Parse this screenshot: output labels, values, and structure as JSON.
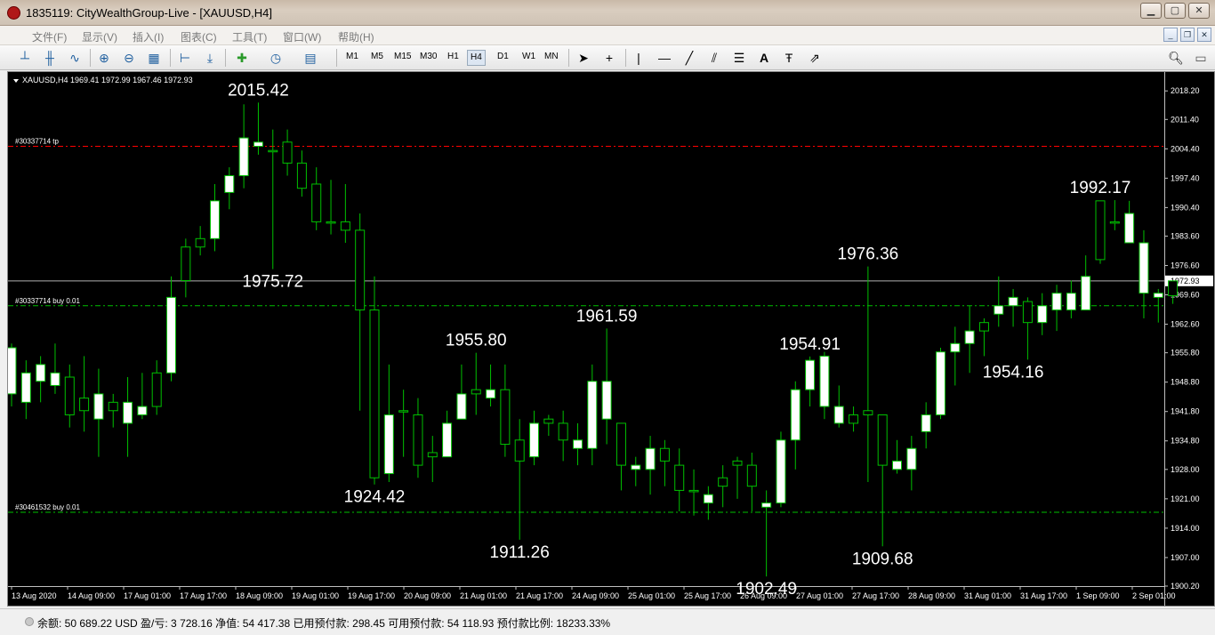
{
  "window": {
    "title": "1835119: CityWealthGroup-Live - [XAUUSD,H4]"
  },
  "menu": [
    "文件(F)",
    "显示(V)",
    "插入(I)",
    "图表(C)",
    "工具(T)",
    "窗口(W)",
    "帮助(H)"
  ],
  "timeframes": [
    "M1",
    "M5",
    "M15",
    "M30",
    "H1",
    "H4",
    "D1",
    "W1",
    "MN"
  ],
  "active_timeframe": "H4",
  "toolbar_icons": [
    "bar-chart-icon",
    "candlestick-icon",
    "line-chart-icon",
    "zoom-in-icon",
    "zoom-out-icon",
    "tile-windows-icon",
    "chart-shift-icon",
    "auto-scroll-icon",
    "new-indicator-icon",
    "periods-icon",
    "templates-icon",
    "cursor-icon",
    "crosshair-icon",
    "vertical-line-icon",
    "horizontal-line-icon",
    "trendline-icon",
    "equidistant-channel-icon",
    "fibonacci-icon",
    "text-icon",
    "text-label-icon",
    "arrows-icon"
  ],
  "colors": {
    "background": "#000000",
    "bull": "#ffffff",
    "bear": "#ffffff",
    "wick": "#00c000",
    "tp_line": "#ff0000",
    "buy_line": "#00c000",
    "text": "#ffffff"
  },
  "chart_data": {
    "type": "candlestick",
    "symbol_info": "XAUUSD,H4  1969.41 1972.99 1967.46 1972.93",
    "ylim": [
      1900.2,
      2021.0
    ],
    "price_ticks": [
      "2018.20",
      "2011.40",
      "2004.40",
      "1997.40",
      "1990.40",
      "1983.60",
      "1976.60",
      "1969.60",
      "1962.60",
      "1955.80",
      "1948.80",
      "1941.80",
      "1934.80",
      "1928.00",
      "1921.00",
      "1914.00",
      "1907.00",
      "1900.20"
    ],
    "current_price": "1972.93",
    "time_labels": [
      "13 Aug 2020",
      "14 Aug 09:00",
      "17 Aug 01:00",
      "17 Aug 17:00",
      "18 Aug 09:00",
      "19 Aug 01:00",
      "19 Aug 17:00",
      "20 Aug 09:00",
      "21 Aug 01:00",
      "21 Aug 17:00",
      "24 Aug 09:00",
      "25 Aug 01:00",
      "25 Aug 17:00",
      "26 Aug 09:00",
      "27 Aug 01:00",
      "27 Aug 17:00",
      "28 Aug 09:00",
      "31 Aug 01:00",
      "31 Aug 17:00",
      "1 Sep 09:00",
      "2 Sep 01:00"
    ],
    "order_lines": [
      {
        "label": "#30337714 tp",
        "price": 2005.0,
        "style": "tp"
      },
      {
        "label": "#30337714 buy 0.01",
        "price": 1967.0,
        "style": "buy"
      },
      {
        "label": "#30461532 buy 0.01",
        "price": 1917.8,
        "style": "buy"
      }
    ],
    "annotations": [
      {
        "text": "2015.42",
        "price": 2015.42,
        "candle": 17
      },
      {
        "text": "1975.72",
        "price": 1975.72,
        "candle": 18
      },
      {
        "text": "1924.42",
        "price": 1924.42,
        "candle": 25
      },
      {
        "text": "1955.80",
        "price": 1955.8,
        "candle": 32
      },
      {
        "text": "1911.26",
        "price": 1911.26,
        "candle": 35
      },
      {
        "text": "1961.59",
        "price": 1961.59,
        "candle": 41
      },
      {
        "text": "1902.49",
        "price": 1902.49,
        "candle": 52
      },
      {
        "text": "1954.91",
        "price": 1954.91,
        "candle": 55
      },
      {
        "text": "1976.36",
        "price": 1976.36,
        "candle": 59
      },
      {
        "text": "1909.68",
        "price": 1909.68,
        "candle": 60
      },
      {
        "text": "1954.16",
        "price": 1954.16,
        "candle": 69
      },
      {
        "text": "1992.17",
        "price": 1992.17,
        "candle": 75
      }
    ],
    "candles": [
      [
        1957,
        1958,
        1943,
        1946
      ],
      [
        1951,
        1954,
        1940,
        1944
      ],
      [
        1953,
        1955,
        1944,
        1949
      ],
      [
        1951,
        1958,
        1946,
        1948
      ],
      [
        1941,
        1953,
        1938,
        1950
      ],
      [
        1942,
        1955,
        1937,
        1945
      ],
      [
        1946,
        1952,
        1931,
        1940
      ],
      [
        1942,
        1946,
        1938,
        1944
      ],
      [
        1944,
        1950,
        1931,
        1939
      ],
      [
        1943,
        1951,
        1940,
        1941
      ],
      [
        1943,
        1954,
        1941,
        1951
      ],
      [
        1969,
        1974,
        1949,
        1951
      ],
      [
        1973,
        1983,
        1969,
        1981
      ],
      [
        1981,
        1986,
        1979,
        1983
      ],
      [
        1992,
        1996,
        1980,
        1983
      ],
      [
        1998,
        2000,
        1990,
        1994
      ],
      [
        2007,
        2015,
        1995,
        1998
      ],
      [
        2006,
        2015.42,
        2003,
        2005
      ],
      [
        2004,
        2009,
        1975.72,
        2004
      ],
      [
        2001,
        2009,
        1998,
        2006
      ],
      [
        1995,
        2004,
        1993,
        2001
      ],
      [
        1987,
        2000,
        1985,
        1996
      ],
      [
        1987,
        1997,
        1984,
        1987
      ],
      [
        1985,
        1996,
        1982,
        1987
      ],
      [
        1966,
        1989,
        1942,
        1985
      ],
      [
        1926,
        1974,
        1924.42,
        1966
      ],
      [
        1941,
        1953,
        1925,
        1927
      ],
      [
        1942,
        1947,
        1931,
        1942
      ],
      [
        1929,
        1945,
        1926,
        1941
      ],
      [
        1931,
        1936,
        1925,
        1932
      ],
      [
        1939,
        1942,
        1931,
        1931
      ],
      [
        1946,
        1953,
        1940,
        1940
      ],
      [
        1946,
        1955.8,
        1941,
        1947
      ],
      [
        1947,
        1953,
        1943,
        1945
      ],
      [
        1934,
        1953,
        1931,
        1947
      ],
      [
        1930,
        1940,
        1911.26,
        1935
      ],
      [
        1939,
        1942,
        1929,
        1931
      ],
      [
        1939,
        1941,
        1936,
        1940
      ],
      [
        1935,
        1942,
        1930,
        1939
      ],
      [
        1935,
        1939,
        1929,
        1933
      ],
      [
        1949,
        1953,
        1929,
        1933
      ],
      [
        1949,
        1961.59,
        1934,
        1940
      ],
      [
        1929,
        1938,
        1923,
        1939
      ],
      [
        1929,
        1931,
        1924,
        1928
      ],
      [
        1933,
        1936,
        1922,
        1928
      ],
      [
        1930,
        1935,
        1924,
        1933
      ],
      [
        1923,
        1933,
        1918,
        1929
      ],
      [
        1923,
        1928,
        1917,
        1923
      ],
      [
        1922,
        1924,
        1916,
        1920
      ],
      [
        1924,
        1929,
        1919,
        1926
      ],
      [
        1929,
        1931,
        1921,
        1930
      ],
      [
        1924,
        1932,
        1918,
        1929
      ],
      [
        1920,
        1923,
        1902.49,
        1919
      ],
      [
        1935,
        1937,
        1919,
        1920
      ],
      [
        1947,
        1949,
        1928,
        1935
      ],
      [
        1954,
        1954.91,
        1943,
        1947
      ],
      [
        1955,
        1956,
        1940,
        1943
      ],
      [
        1943,
        1948,
        1938,
        1939
      ],
      [
        1939,
        1943,
        1937,
        1941
      ],
      [
        1941,
        1976.36,
        1925,
        1942
      ],
      [
        1929,
        1941,
        1909.68,
        1941
      ],
      [
        1930,
        1935,
        1927,
        1928
      ],
      [
        1933,
        1936,
        1923,
        1928
      ],
      [
        1941,
        1944,
        1933,
        1937
      ],
      [
        1956,
        1957,
        1940,
        1941
      ],
      [
        1958,
        1962,
        1948,
        1956
      ],
      [
        1961,
        1967,
        1951,
        1958
      ],
      [
        1961,
        1964,
        1955,
        1963
      ],
      [
        1967,
        1974,
        1962,
        1965
      ],
      [
        1969,
        1971,
        1962,
        1967
      ],
      [
        1963,
        1969,
        1954.16,
        1968
      ],
      [
        1967,
        1970,
        1960,
        1963
      ],
      [
        1970,
        1972,
        1961,
        1966
      ],
      [
        1970,
        1973,
        1964,
        1966
      ],
      [
        1974,
        1979,
        1966,
        1966
      ],
      [
        1978,
        1992,
        1977,
        1992
      ],
      [
        1987,
        1992.17,
        1985,
        1987
      ],
      [
        1989,
        1992,
        1984,
        1982
      ],
      [
        1982,
        1985,
        1964,
        1970
      ],
      [
        1970,
        1971,
        1963,
        1969
      ],
      [
        1969.41,
        1972.99,
        1967.46,
        1972.93
      ]
    ]
  },
  "status": {
    "text": "余额: 50 689.22 USD   盈/亏: 3 728.16   净值: 54 417.38   已用预付款: 298.45   可用预付款: 54 118.93   预付款比例: 18233.33%"
  }
}
